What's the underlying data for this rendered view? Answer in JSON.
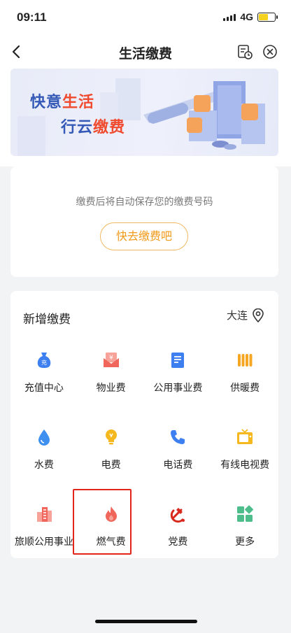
{
  "status": {
    "time": "09:11",
    "network": "4G"
  },
  "nav": {
    "title": "生活缴费"
  },
  "banner": {
    "line1_a": "快意",
    "line1_b": "生活",
    "line2_a": "行云",
    "line2_b": "缴费"
  },
  "empty_card": {
    "message": "缴费后将自动保存您的缴费号码",
    "button": "快去缴费吧"
  },
  "services": {
    "title": "新增缴费",
    "city": "大连",
    "items": [
      {
        "label": "充值中心",
        "icon": "money-bag-icon",
        "color": "#3d7ff0"
      },
      {
        "label": "物业费",
        "icon": "envelope-icon",
        "color": "#f0665a"
      },
      {
        "label": "公用事业费",
        "icon": "document-icon",
        "color": "#3d7ff0"
      },
      {
        "label": "供暖费",
        "icon": "radiator-icon",
        "color": "#f5a623"
      },
      {
        "label": "水费",
        "icon": "water-drop-icon",
        "color": "#3d8ff0"
      },
      {
        "label": "电费",
        "icon": "light-bulb-icon",
        "color": "#f5b81f"
      },
      {
        "label": "电话费",
        "icon": "phone-icon",
        "color": "#3d7ff0"
      },
      {
        "label": "有线电视费",
        "icon": "tv-icon",
        "color": "#f5b81f"
      },
      {
        "label": "旅顺公用事业",
        "icon": "building-icon",
        "color": "#f0665a"
      },
      {
        "label": "燃气费",
        "icon": "flame-icon",
        "color": "#f0665a"
      },
      {
        "label": "党费",
        "icon": "party-emblem-icon",
        "color": "#d9281c"
      },
      {
        "label": "更多",
        "icon": "grid-more-icon",
        "color": "#4dbd8c"
      }
    ]
  }
}
